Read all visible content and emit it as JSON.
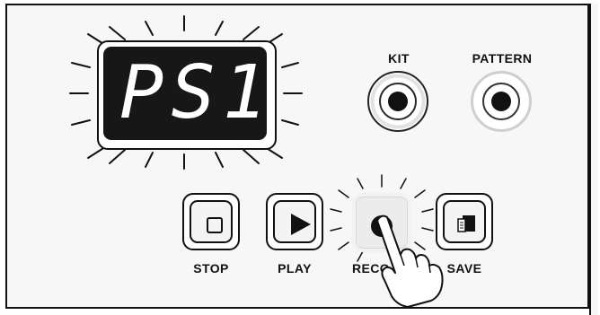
{
  "display": {
    "text": "PS1"
  },
  "knobs": {
    "kit_label": "KIT",
    "pattern_label": "PATTERN"
  },
  "buttons": {
    "stop_label": "STOP",
    "play_label": "PLAY",
    "record_label": "RECO",
    "save_label": "SAVE"
  },
  "icons": {
    "stop": "stop-square-icon",
    "play": "play-triangle-icon",
    "record": "record-dot-icon",
    "save": "save-icon",
    "cursor": "hand-pointer-icon"
  }
}
